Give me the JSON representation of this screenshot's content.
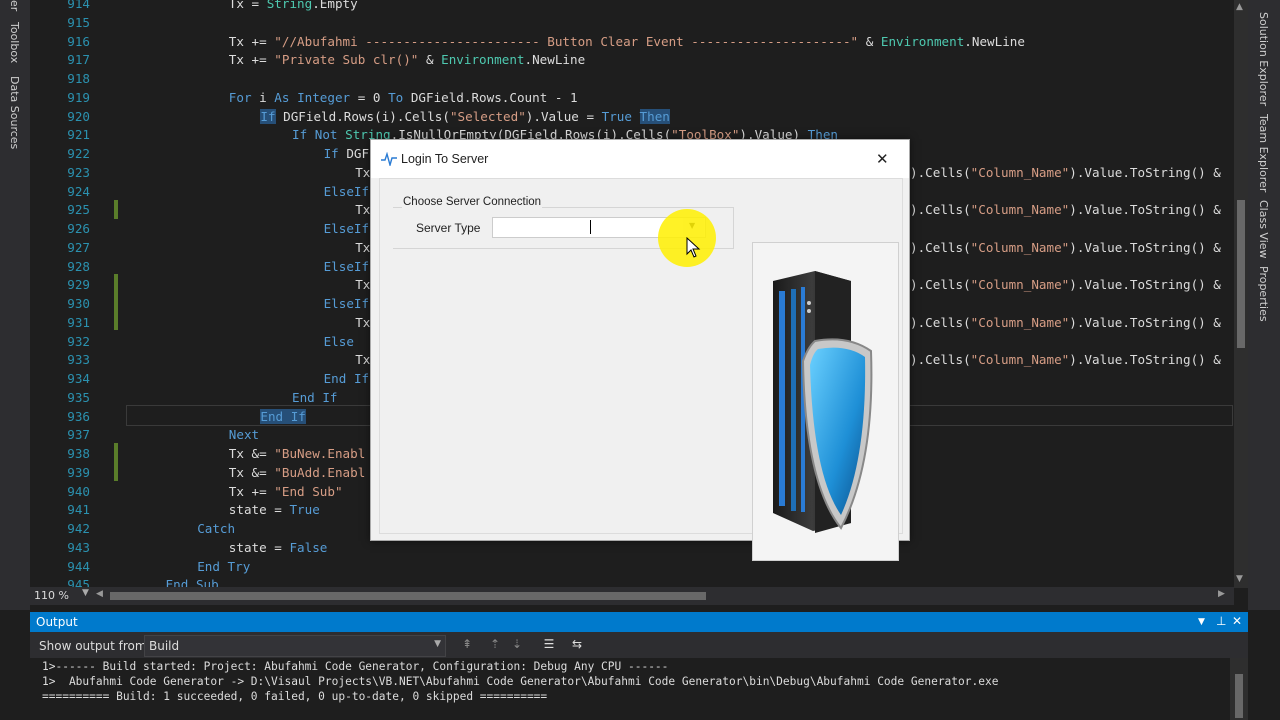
{
  "left_tabs": [
    "er",
    "Toolbox",
    "Data Sources"
  ],
  "right_tabs": [
    "Solution Explorer",
    "Team Explorer",
    "Class View",
    "Properties"
  ],
  "code_lines": [
    {
      "n": "914",
      "indent": 12,
      "tokens": [
        [
          "Tx = ",
          ""
        ],
        [
          "String",
          "ty"
        ],
        [
          ".Empty",
          ""
        ]
      ]
    },
    {
      "n": "915",
      "indent": 0,
      "tokens": []
    },
    {
      "n": "916",
      "indent": 12,
      "tokens": [
        [
          "Tx += ",
          ""
        ],
        [
          "\"//Abufahmi ----------------------- Button Clear Event ---------------------\"",
          "st"
        ],
        [
          " & ",
          ""
        ],
        [
          "Environment",
          "ty"
        ],
        [
          ".NewLine",
          ""
        ]
      ]
    },
    {
      "n": "917",
      "indent": 12,
      "tokens": [
        [
          "Tx += ",
          ""
        ],
        [
          "\"Private Sub clr()\"",
          "st"
        ],
        [
          " & ",
          ""
        ],
        [
          "Environment",
          "ty"
        ],
        [
          ".NewLine",
          ""
        ]
      ]
    },
    {
      "n": "918",
      "indent": 0,
      "tokens": []
    },
    {
      "n": "919",
      "indent": 12,
      "tokens": [
        [
          "For",
          "kw"
        ],
        [
          " i ",
          ""
        ],
        [
          "As",
          "kw"
        ],
        [
          " ",
          ""
        ],
        [
          "Integer",
          "kw"
        ],
        [
          " = 0 ",
          ""
        ],
        [
          "To",
          "kw"
        ],
        [
          " DGField.Rows.Count - 1",
          ""
        ]
      ]
    },
    {
      "n": "920",
      "indent": 16,
      "tokens": [
        [
          "If",
          "hl"
        ],
        [
          " DGField.Rows(i).Cells(",
          ""
        ],
        [
          "\"Selected\"",
          "st"
        ],
        [
          ").Value = ",
          ""
        ],
        [
          "True",
          "kw"
        ],
        [
          " ",
          ""
        ],
        [
          "Then",
          "hl"
        ]
      ]
    },
    {
      "n": "921",
      "indent": 20,
      "tokens": [
        [
          "If",
          "kw"
        ],
        [
          " ",
          ""
        ],
        [
          "Not",
          "kw"
        ],
        [
          " ",
          ""
        ],
        [
          "String",
          "ty"
        ],
        [
          ".IsNullOrEmpty(DGField.Rows(i).Cells(",
          ""
        ],
        [
          "\"ToolBox\"",
          "st"
        ],
        [
          ").Value) ",
          ""
        ],
        [
          "Then",
          "kw"
        ]
      ]
    },
    {
      "n": "922",
      "indent": 24,
      "tokens": [
        [
          "If",
          "kw"
        ],
        [
          " DGF",
          ""
        ]
      ]
    },
    {
      "n": "923",
      "indent": 28,
      "tokens": [
        [
          "Tx",
          ""
        ]
      ],
      "tail": true
    },
    {
      "n": "924",
      "indent": 24,
      "tokens": [
        [
          "ElseIf",
          "kw"
        ]
      ]
    },
    {
      "n": "925",
      "indent": 28,
      "tokens": [
        [
          "Tx",
          ""
        ]
      ],
      "tail": true
    },
    {
      "n": "926",
      "indent": 24,
      "tokens": [
        [
          "ElseIf",
          "kw"
        ]
      ]
    },
    {
      "n": "927",
      "indent": 28,
      "tokens": [
        [
          "Tx",
          ""
        ]
      ],
      "tail": true
    },
    {
      "n": "928",
      "indent": 24,
      "tokens": [
        [
          "ElseIf",
          "kw"
        ]
      ]
    },
    {
      "n": "929",
      "indent": 28,
      "tokens": [
        [
          "Tx",
          ""
        ]
      ],
      "tail": true
    },
    {
      "n": "930",
      "indent": 24,
      "tokens": [
        [
          "ElseIf",
          "kw"
        ]
      ]
    },
    {
      "n": "931",
      "indent": 28,
      "tokens": [
        [
          "Tx",
          ""
        ]
      ],
      "tail": true
    },
    {
      "n": "932",
      "indent": 24,
      "tokens": [
        [
          "Else",
          "kw"
        ]
      ]
    },
    {
      "n": "933",
      "indent": 28,
      "tokens": [
        [
          "Tx",
          ""
        ]
      ],
      "tail": true
    },
    {
      "n": "934",
      "indent": 24,
      "tokens": [
        [
          "End",
          "kw"
        ],
        [
          " ",
          ""
        ],
        [
          "If",
          "kw"
        ]
      ]
    },
    {
      "n": "935",
      "indent": 20,
      "tokens": [
        [
          "End",
          "kw"
        ],
        [
          " ",
          ""
        ],
        [
          "If",
          "kw"
        ]
      ]
    },
    {
      "n": "936",
      "indent": 16,
      "tokens": [
        [
          "End If",
          "hl"
        ]
      ]
    },
    {
      "n": "937",
      "indent": 12,
      "tokens": [
        [
          "Next",
          "kw"
        ]
      ]
    },
    {
      "n": "938",
      "indent": 12,
      "tokens": [
        [
          "Tx &= ",
          ""
        ],
        [
          "\"BuNew.Enabl",
          "st"
        ]
      ]
    },
    {
      "n": "939",
      "indent": 12,
      "tokens": [
        [
          "Tx &= ",
          ""
        ],
        [
          "\"BuAdd.Enabl",
          "st"
        ]
      ]
    },
    {
      "n": "940",
      "indent": 12,
      "tokens": [
        [
          "Tx += ",
          ""
        ],
        [
          "\"End Sub\"",
          "st"
        ]
      ]
    },
    {
      "n": "941",
      "indent": 12,
      "tokens": [
        [
          "state = ",
          ""
        ],
        [
          "True",
          "kw"
        ]
      ]
    },
    {
      "n": "942",
      "indent": 8,
      "tokens": [
        [
          "Catch",
          "kw"
        ]
      ]
    },
    {
      "n": "943",
      "indent": 12,
      "tokens": [
        [
          "state = ",
          ""
        ],
        [
          "False",
          "kw"
        ]
      ]
    },
    {
      "n": "944",
      "indent": 8,
      "tokens": [
        [
          "End",
          "kw"
        ],
        [
          " ",
          ""
        ],
        [
          "Try",
          "kw"
        ]
      ]
    },
    {
      "n": "945",
      "indent": 4,
      "tokens": [
        [
          "End",
          "kw"
        ],
        [
          " ",
          ""
        ],
        [
          "Sub",
          "kw"
        ]
      ]
    }
  ],
  "tail_tokens": [
    [
      ").Cells(",
      ""
    ],
    [
      "\"Column_Name\"",
      "st"
    ],
    [
      ").Value.ToString() &",
      ""
    ]
  ],
  "zoom": "110 %",
  "output": {
    "title": "Output",
    "show_label": "Show output from:",
    "source": "Build",
    "lines": [
      "1>------ Build started: Project: Abufahmi Code Generator, Configuration: Debug Any CPU ------",
      "1>  Abufahmi Code Generator -> D:\\Visaul Projects\\VB.NET\\Abufahmi Code Generator\\Abufahmi Code Generator\\bin\\Debug\\Abufahmi Code Generator.exe",
      "========== Build: 1 succeeded, 0 failed, 0 up-to-date, 0 skipped =========="
    ]
  },
  "dialog": {
    "title": "Login To Server",
    "group_title": "Choose Server Connection",
    "server_type_label": "Server Type",
    "server_type_value": ""
  },
  "colors": {
    "accent": "#007acc",
    "cursor_highlight": "#ffee00",
    "shield": "#1e8fd6"
  }
}
